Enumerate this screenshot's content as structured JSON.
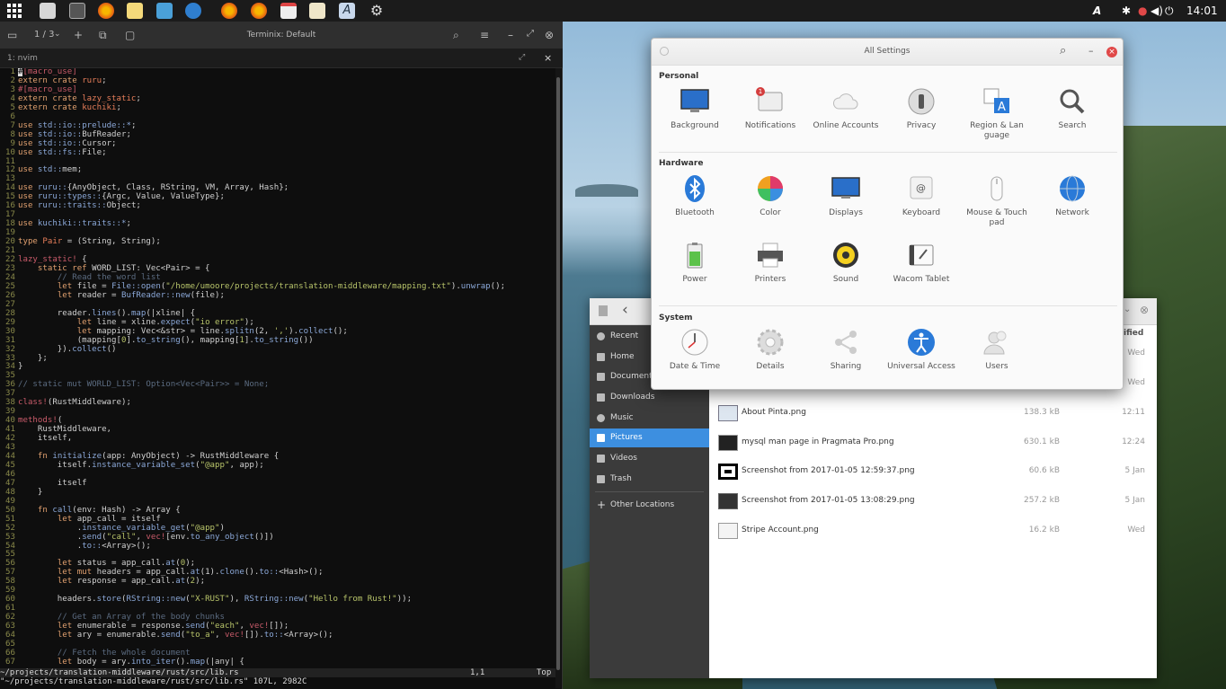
{
  "panel": {
    "clock": "14:01",
    "launchers": [
      "files-icon",
      "terminal-icon",
      "firefox-icon",
      "notes-icon",
      "store-icon",
      "tor-icon",
      "firefox-icon",
      "firefox-icon",
      "calendar-icon",
      "editor-icon",
      "fonts-icon",
      "settings-icon"
    ],
    "tray_icons": [
      "fonts-icon",
      "bluetooth-icon",
      "notification-icon",
      "volume-icon",
      "power-icon"
    ]
  },
  "terminal": {
    "title": "Terminix: Default",
    "pager": "1 / 3",
    "tab_label": "1: nvim",
    "status_line": "~/projects/translation-middleware/rust/src/lib.rs",
    "status_pos": "1,1",
    "status_top": "Top",
    "message_line": "\"~/projects/translation-middleware/rust/src/lib.rs\" 107L, 2982C"
  },
  "settings": {
    "title": "All Settings",
    "sections": {
      "personal": "Personal",
      "hardware": "Hardware",
      "system": "System"
    },
    "personal": [
      "Background",
      "Notifications",
      "Online Accounts",
      "Privacy",
      "Region & Lan\nguage",
      "Search"
    ],
    "notifications_badge": "1",
    "hardware": [
      "Bluetooth",
      "Color",
      "Displays",
      "Keyboard",
      "Mouse & Touch\npad",
      "Network",
      "Power",
      "Printers",
      "Sound",
      "Wacom Tablet"
    ],
    "system": [
      "Date & Time",
      "Details",
      "Sharing",
      "Universal Access",
      "Users"
    ]
  },
  "files": {
    "sidebar": [
      "Recent",
      "Home",
      "Documents",
      "Downloads",
      "Music",
      "Pictures",
      "Videos",
      "Trash",
      "Other Locations"
    ],
    "selected": "Pictures",
    "header_partial": "ified",
    "rows": [
      {
        "name": "",
        "size": "",
        "date": "Wed"
      },
      {
        "name": "",
        "size": "",
        "date": "Wed"
      },
      {
        "name": "About Pinta.png",
        "size": "138.3 kB",
        "date": "12:11"
      },
      {
        "name": "mysql man page in Pragmata Pro.png",
        "size": "630.1 kB",
        "date": "12:24"
      },
      {
        "name": "Screenshot from 2017-01-05 12:59:37.png",
        "size": "60.6 kB",
        "date": "5 Jan"
      },
      {
        "name": "Screenshot from 2017-01-05 13:08:29.png",
        "size": "257.2 kB",
        "date": "5 Jan"
      },
      {
        "name": "Stripe Account.png",
        "size": "16.2 kB",
        "date": "Wed"
      }
    ]
  }
}
